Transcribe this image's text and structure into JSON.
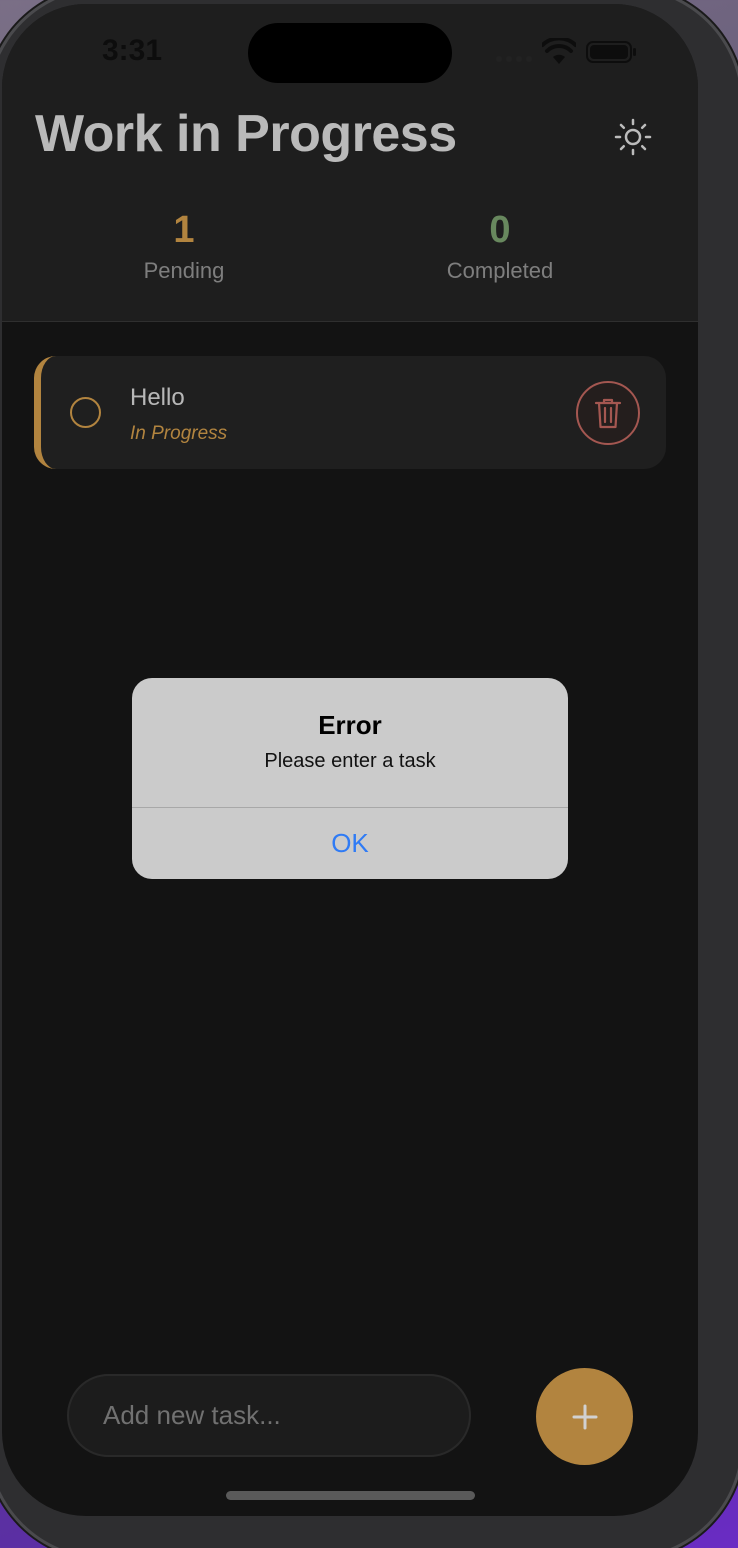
{
  "status_bar": {
    "time": "3:31"
  },
  "header": {
    "title": "Work in Progress"
  },
  "stats": {
    "pending": {
      "value": "1",
      "label": "Pending",
      "color": "#d9a24e"
    },
    "completed": {
      "value": "0",
      "label": "Completed",
      "color": "#7fa673"
    }
  },
  "tasks": [
    {
      "title": "Hello",
      "status": "In Progress"
    }
  ],
  "alert": {
    "title": "Error",
    "message": "Please enter a task",
    "ok_label": "OK"
  },
  "composer": {
    "placeholder": "Add new task...",
    "add_icon": "plus-icon"
  },
  "icons": {
    "theme_toggle": "sun-icon",
    "delete": "trash-icon",
    "status": [
      "wifi-icon",
      "battery-icon"
    ]
  },
  "colors": {
    "accent": "#d9a24e",
    "completed": "#7fa673",
    "delete": "#c96b63",
    "link": "#2f7bf5"
  }
}
